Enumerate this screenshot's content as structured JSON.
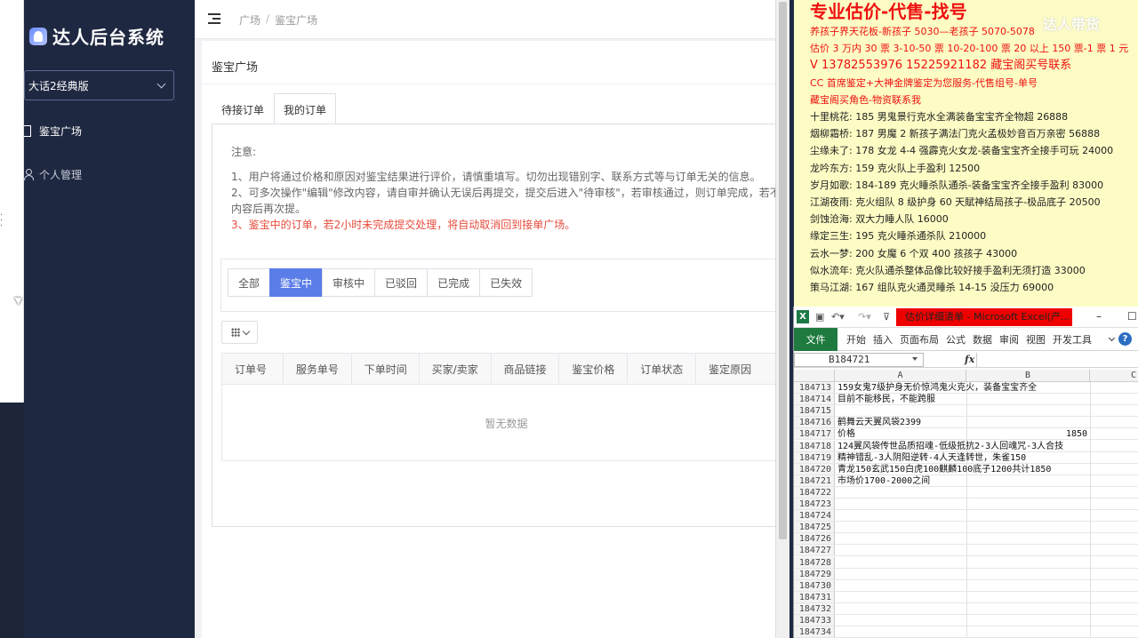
{
  "sidebar": {
    "logo_text": "达人后台系统",
    "version_select": "大话2经典版",
    "nav": [
      {
        "label": "鉴宝广场",
        "icon": "plaza-icon"
      },
      {
        "label": "个人管理",
        "icon": "user-icon"
      }
    ]
  },
  "header": {
    "breadcrumb": [
      "广场",
      "/",
      "鉴宝广场"
    ]
  },
  "main": {
    "page_title": "鉴宝广场",
    "tabs": [
      "待接订单",
      "我的订单"
    ],
    "notice": {
      "title": "注意:",
      "line1": "1、用户将通过价格和原因对鉴宝结果进行评价，请慎重填写。切勿出现错别字、联系方式等与订单无关的信息。",
      "line2": "2、可多次操作\"编辑\"修改内容，请自审并确认无误后再提交，提交后进入\"待审核\"，若审核通过，则订单完成，若不",
      "line2b": "内容后再次提。",
      "line3": "3、鉴宝中的订单，若2小时未完成提交处理，将自动取消回到接单广场。"
    },
    "filters": [
      "全部",
      "鉴宝中",
      "审核中",
      "已驳回",
      "已完成",
      "已失效"
    ],
    "table": {
      "columns": [
        "订单号",
        "服务单号",
        "下单时间",
        "买家/卖家",
        "商品链接",
        "鉴宝价格",
        "订单状态",
        "鉴定原因"
      ],
      "empty_text": "暂无数据"
    }
  },
  "ad": {
    "headline": "专业估价-代售-找号",
    "lines_red": [
      "养孩子界天花板-新孩子 5030—老孩子 5070-5078",
      "估价 3 万内 30 票  3-10-50 票  10-20-100 票 20 以上 150 票-1 票 1 元",
      "V 13782553976    15225921182  藏宝阁买号联系",
      "CC 首席鉴定+大神金牌鉴定为您服务-代售组号-单号",
      "藏宝阁买角色-物资联系我"
    ],
    "listings": [
      "十里桃花: 185 男鬼景行克水全满装备宝宝齐全物超 26888",
      "烟柳霜桥: 187 男魔 2 新孩子满法门克火孟极妙音百万亲密 56888",
      "尘缘未了: 178 女龙 4-4 强霹克火女龙-装备宝宝齐全接手可玩 24000",
      "龙吟东方: 159 克火队上手盈利 12500",
      "岁月如歌: 184-189 克火睡杀队通杀-装备宝宝齐全接手盈利 83000",
      "江湖夜雨: 克火组队 8 级护身 60 天賦神结局孩子-极品底子 20500",
      "剑蚀沧海: 双大力睡人队 16000",
      "缘定三生: 195 克火睡杀通杀队 210000",
      "云水一梦: 200 女魔 6 个双 400 孩孩子 43000",
      "似水流年: 克火队通杀整体品像比较好接手盈利无须打造 33000",
      "策马江湖: 167 组队克火通灵睡杀 14-15 没压力 69000"
    ],
    "watermark": "达人带货"
  },
  "excel": {
    "caption": "估价详细清单 - Microsoft Excel(产...",
    "ribbon_tabs": [
      "文件",
      "开始",
      "插入",
      "页面布局",
      "公式",
      "数据",
      "审阅",
      "视图",
      "开发工具"
    ],
    "name_box": "B184721",
    "fx": "fx",
    "columns": [
      "A",
      "B",
      "C"
    ],
    "rows": [
      {
        "n": "184713",
        "text": "159女鬼7级护身无价惊鸿鬼火克火，装备宝宝齐全",
        "price": ""
      },
      {
        "n": "184714",
        "text": "目前不能移民，不能跨服",
        "price": ""
      },
      {
        "n": "184715",
        "text": "",
        "price": ""
      },
      {
        "n": "184716",
        "text": "鹤舞云天翼风袋2399",
        "price": ""
      },
      {
        "n": "184717",
        "text": "价格",
        "price": "1850"
      },
      {
        "n": "184718",
        "text": "124翼风袋传世品质招魂-低级抵抗2-3人回魂咒-3人合技",
        "price": ""
      },
      {
        "n": "184719",
        "text": "精神错乱-3人阴阳逆转-4人天逢转世，朱雀150",
        "price": ""
      },
      {
        "n": "184720",
        "text": "青龙150玄武150白虎100麒麟100底子1200共计1850",
        "price": ""
      },
      {
        "n": "184721",
        "text": "市场价1700-2000之间",
        "price": ""
      },
      {
        "n": "184722",
        "text": "",
        "price": ""
      },
      {
        "n": "184723",
        "text": "",
        "price": ""
      },
      {
        "n": "184724",
        "text": "",
        "price": ""
      },
      {
        "n": "184725",
        "text": "",
        "price": ""
      },
      {
        "n": "184726",
        "text": "",
        "price": ""
      },
      {
        "n": "184727",
        "text": "",
        "price": ""
      },
      {
        "n": "184728",
        "text": "",
        "price": ""
      },
      {
        "n": "184729",
        "text": "",
        "price": ""
      },
      {
        "n": "184730",
        "text": "",
        "price": ""
      },
      {
        "n": "184731",
        "text": "",
        "price": ""
      },
      {
        "n": "184732",
        "text": "",
        "price": ""
      },
      {
        "n": "184733",
        "text": "",
        "price": ""
      },
      {
        "n": "184734",
        "text": "",
        "price": ""
      }
    ]
  }
}
